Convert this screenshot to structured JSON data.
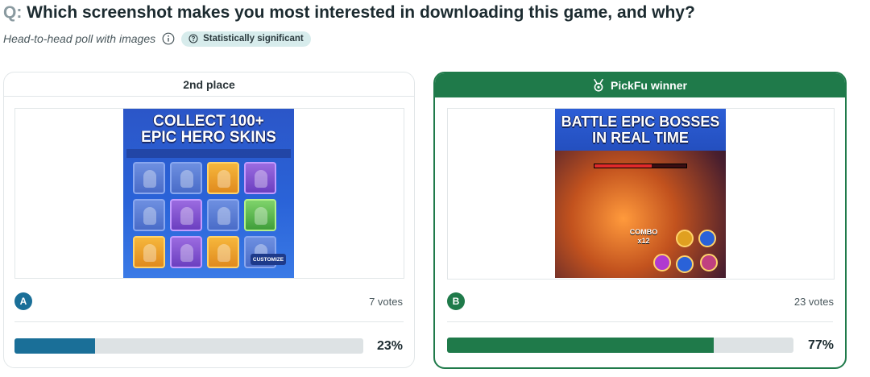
{
  "question": {
    "prefix": "Q:",
    "text": "Which screenshot makes you most interested in downloading this game, and why?"
  },
  "poll": {
    "type_label": "Head-to-head poll with images",
    "significance_badge": "Statistically significant"
  },
  "options": {
    "a": {
      "place_label": "2nd place",
      "letter": "A",
      "votes_text": "7 votes",
      "percent_text": "23%",
      "percent": 23,
      "accent_color": "#1a6f98",
      "image": {
        "title_line1": "COLLECT 100+",
        "title_line2": "EPIC HERO SKINS",
        "button_label": "CUSTOMIZE"
      }
    },
    "b": {
      "place_label": "PickFu winner",
      "winner_icon": "medal-icon",
      "letter": "B",
      "votes_text": "23 votes",
      "percent_text": "77%",
      "percent": 77,
      "accent_color": "#1f7a4a",
      "image": {
        "title_line1": "BATTLE EPIC BOSSES",
        "title_line2": "IN REAL TIME",
        "combo_label": "COMBO",
        "combo_value": "x12"
      }
    }
  }
}
